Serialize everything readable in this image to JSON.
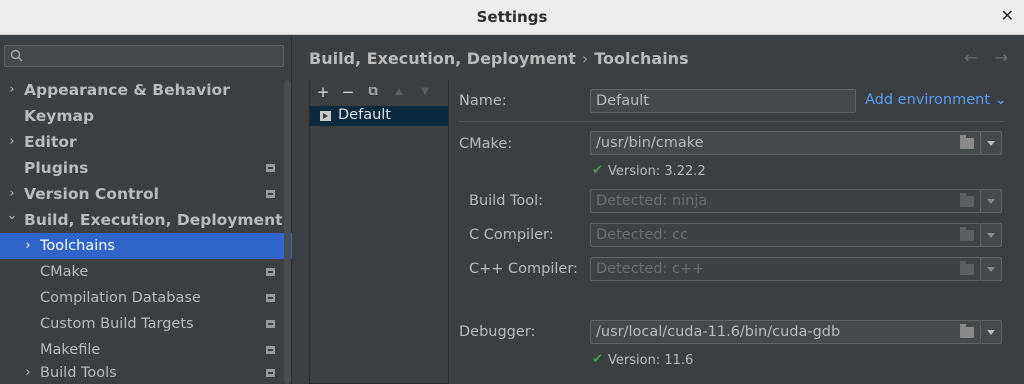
{
  "window": {
    "title": "Settings",
    "close_glyph": "✕"
  },
  "search": {
    "placeholder": "",
    "value": ""
  },
  "sidebar": {
    "items": [
      {
        "label": "Appearance & Behavior",
        "arrow": "›"
      },
      {
        "label": "Keymap",
        "arrow": ""
      },
      {
        "label": "Editor",
        "arrow": "›"
      },
      {
        "label": "Plugins",
        "arrow": ""
      },
      {
        "label": "Version Control",
        "arrow": "›"
      },
      {
        "label": "Build, Execution, Deployment",
        "arrow": "⌄"
      },
      {
        "label": "Toolchains",
        "arrow": "›"
      },
      {
        "label": "CMake",
        "arrow": ""
      },
      {
        "label": "Compilation Database",
        "arrow": ""
      },
      {
        "label": "Custom Build Targets",
        "arrow": ""
      },
      {
        "label": "Makefile",
        "arrow": ""
      },
      {
        "label": "Build Tools",
        "arrow": "›"
      }
    ]
  },
  "breadcrumb": {
    "parent": "Build, Execution, Deployment",
    "separator": "›",
    "current": "Toolchains"
  },
  "nav": {
    "back": "←",
    "forward": "→"
  },
  "toolbar": {
    "add": "+",
    "remove": "−",
    "copy": "⧉",
    "up": "▲",
    "down": "▼"
  },
  "toolchains": [
    {
      "name": "Default"
    }
  ],
  "form": {
    "name_label": "Name:",
    "name_value": "Default",
    "add_environment": "Add environment ⌄",
    "cmake_label": "CMake:",
    "cmake_value": "/usr/bin/cmake",
    "cmake_version": "Version: 3.22.2",
    "build_tool_label": "Build Tool:",
    "build_tool_placeholder": "Detected: ninja",
    "c_compiler_label": "C Compiler:",
    "c_compiler_placeholder": "Detected: cc",
    "cpp_compiler_label": "C++ Compiler:",
    "cpp_compiler_placeholder": "Detected: c++",
    "debugger_label": "Debugger:",
    "debugger_value": "/usr/local/cuda-11.6/bin/cuda-gdb",
    "debugger_version": "Version: 11.6",
    "check_glyph": "✔"
  },
  "colors": {
    "accent": "#2f65ca",
    "link": "#589df6",
    "ok": "#499c54",
    "background": "#3c3f41"
  }
}
